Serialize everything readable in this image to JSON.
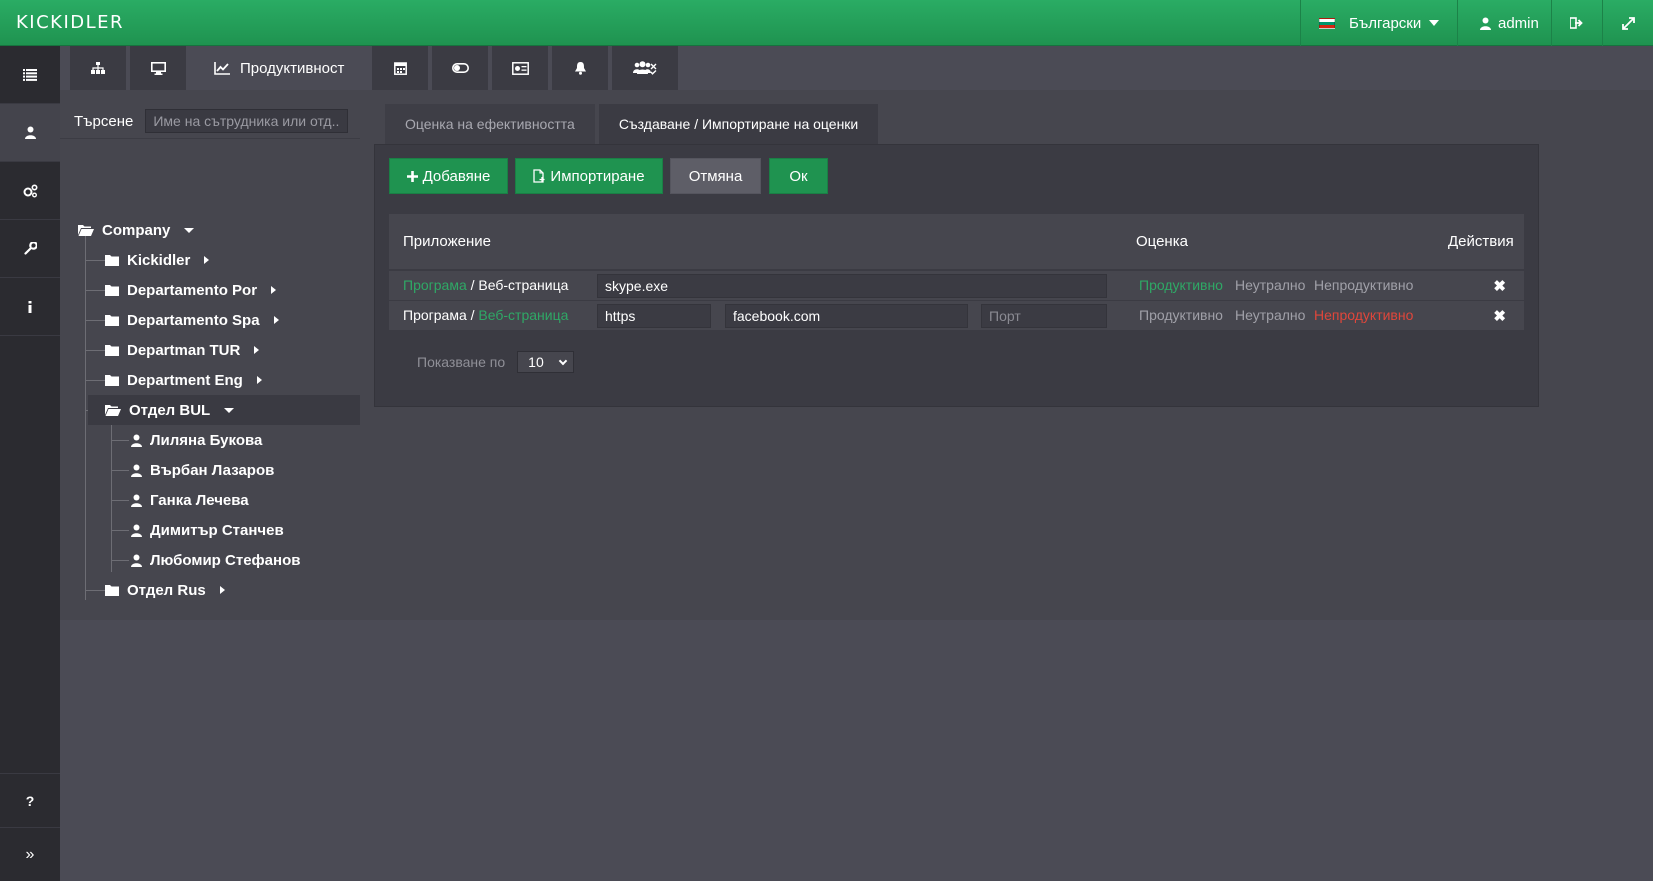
{
  "header": {
    "logo": "KICKIDLER",
    "language": "Български",
    "user": "admin"
  },
  "toolbar": {
    "active_label": "Продуктивност"
  },
  "search": {
    "label": "Търсене",
    "placeholder": "Име на сътрудника или отд..."
  },
  "tree": {
    "root": "Company",
    "departments": [
      "Kickidler",
      "Departamento Por",
      "Departamento Spa",
      "Departman TUR",
      "Department Eng"
    ],
    "selected_department": "Отдел BUL",
    "employees": [
      "Лиляна Букова",
      "Върбан Лазаров",
      "Ганка Лечева",
      "Димитър Станчев",
      "Любомир Стефанов"
    ],
    "last_department": "Отдел Rus"
  },
  "tabs": {
    "efficiency": "Оценка на ефективността",
    "create_import": "Създаване / Импортиране на оценки"
  },
  "buttons": {
    "add": "Добавяне",
    "import": "Импортиране",
    "cancel": "Отмяна",
    "ok": "Ок"
  },
  "table": {
    "col_app": "Приложение",
    "col_rating": "Оценка",
    "col_actions": "Действия",
    "program_label": "Програма",
    "separator": " / ",
    "website_label": "Веб-страница",
    "productive": "Продуктивно",
    "neutral": "Неутрално",
    "unproductive": "Непродуктивно",
    "rows": [
      {
        "type": "program",
        "value": "skype.exe",
        "rating": "productive"
      },
      {
        "type": "website",
        "protocol": "https",
        "domain": "facebook.com",
        "port_placeholder": "Порт",
        "rating": "unproductive"
      }
    ]
  },
  "pager": {
    "label": "Показване по",
    "value": "10"
  },
  "colors": {
    "accent_green": "#1f9350",
    "link_green": "#2fa866",
    "danger_red": "#e0463b"
  }
}
